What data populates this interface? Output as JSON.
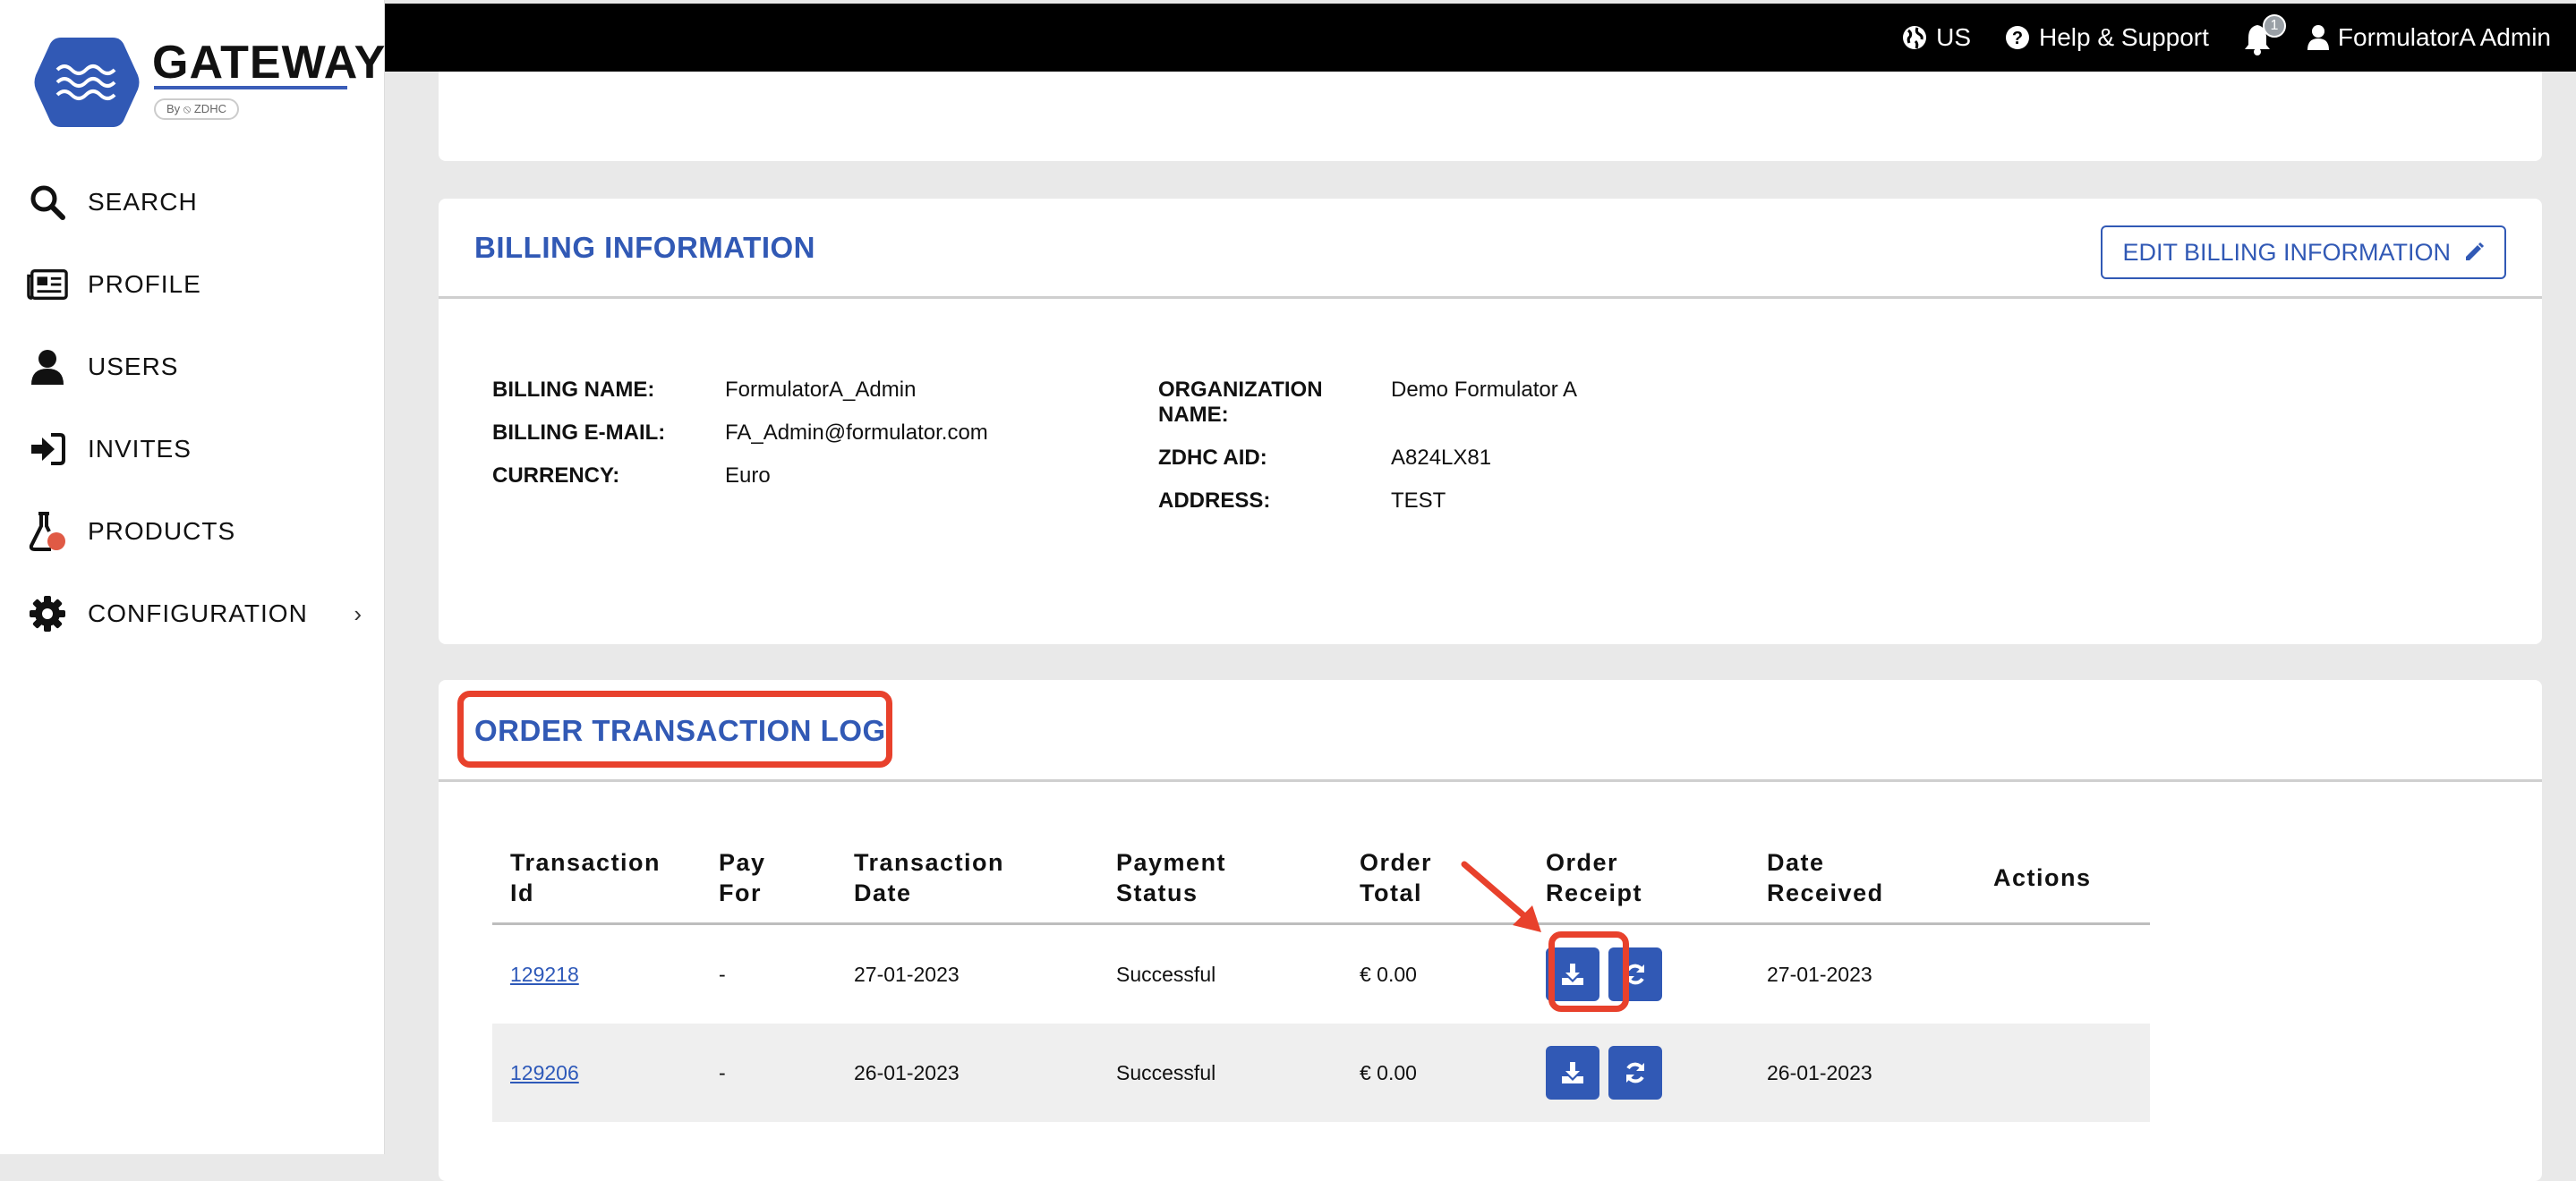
{
  "brand": {
    "name": "GATEWAY",
    "byline": "By ⦸ ZDHC"
  },
  "sidebar": {
    "items": [
      {
        "label": "SEARCH",
        "icon": "search-icon"
      },
      {
        "label": "PROFILE",
        "icon": "newspaper-icon"
      },
      {
        "label": "USERS",
        "icon": "user-icon"
      },
      {
        "label": "INVITES",
        "icon": "sign-in-icon"
      },
      {
        "label": "PRODUCTS",
        "icon": "flask-icon"
      },
      {
        "label": "CONFIGURATION",
        "icon": "gear-icon"
      }
    ]
  },
  "topbar": {
    "region": "US",
    "help": "Help & Support",
    "notifications": "1",
    "user": "FormulatorA Admin"
  },
  "billing": {
    "title": "BILLING INFORMATION",
    "edit_label": "EDIT BILLING INFORMATION",
    "left": [
      {
        "label": "BILLING NAME:",
        "value": "FormulatorA_Admin"
      },
      {
        "label": "BILLING E-MAIL:",
        "value": "FA_Admin@formulator.com"
      },
      {
        "label": "CURRENCY:",
        "value": "Euro"
      }
    ],
    "right": [
      {
        "label": "ORGANIZATION NAME:",
        "value": "Demo Formulator A"
      },
      {
        "label": "ZDHC AID:",
        "value": "A824LX81"
      },
      {
        "label": "ADDRESS:",
        "value": "TEST"
      }
    ]
  },
  "log": {
    "title": "ORDER TRANSACTION LOG",
    "columns": [
      "Transaction Id",
      "Pay For",
      "Transaction Date",
      "Payment Status",
      "Order Total",
      "Order Receipt",
      "Date Received",
      "Actions"
    ],
    "rows": [
      {
        "id": "129218",
        "pay_for": "-",
        "date": "27-01-2023",
        "status": "Successful",
        "total": "€ 0.00",
        "received": "27-01-2023"
      },
      {
        "id": "129206",
        "pay_for": "-",
        "date": "26-01-2023",
        "status": "Successful",
        "total": "€ 0.00",
        "received": "26-01-2023"
      }
    ]
  },
  "colors": {
    "accent": "#3159b5",
    "highlight": "#e8412c"
  }
}
